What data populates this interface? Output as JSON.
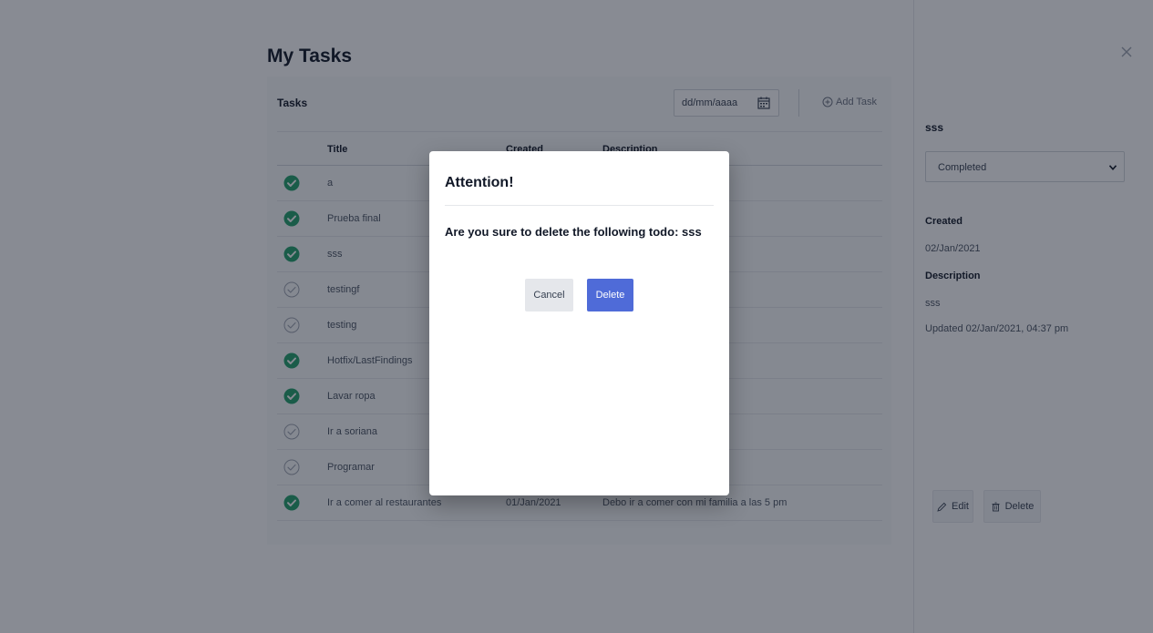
{
  "colors": {
    "accent": "#4f6bd8",
    "completed_green": "#22a06b",
    "pending_gray": "#9ca3af",
    "overlay": "#111827"
  },
  "page": {
    "title": "My Tasks"
  },
  "tasks_card": {
    "title": "Tasks",
    "date_placeholder": "dd/mm/aaaa",
    "calendar_icon": "calendar-icon",
    "add_task_label": "Add Task",
    "add_task_icon": "plus-circle-icon",
    "columns": [
      "Title",
      "Created",
      "Description"
    ],
    "rows": [
      {
        "status": "completed",
        "title": "a",
        "created": "",
        "description": ""
      },
      {
        "status": "completed",
        "title": "Prueba final",
        "created": "",
        "description": ""
      },
      {
        "status": "completed",
        "title": "sss",
        "created": "",
        "description": ""
      },
      {
        "status": "pending",
        "title": "testingf",
        "created": "",
        "description": ""
      },
      {
        "status": "pending",
        "title": "testing",
        "created": "",
        "description": ""
      },
      {
        "status": "completed",
        "title": "Hotfix/LastFindings",
        "created": "",
        "description": ""
      },
      {
        "status": "completed",
        "title": "Lavar ropa",
        "created": "",
        "description": ""
      },
      {
        "status": "pending",
        "title": "Ir a soriana",
        "created": "",
        "description": ""
      },
      {
        "status": "pending",
        "title": "Programar",
        "created": "",
        "description": ""
      },
      {
        "status": "completed",
        "title": "Ir a comer al restaurantes",
        "created": "01/Jan/2021",
        "description": "Debo ir a comer con mi familia a las 5 pm"
      }
    ]
  },
  "side_panel": {
    "close_icon": "close-icon",
    "task_name": "sss",
    "status_value": "Completed",
    "created_label": "Created",
    "created_value": "02/Jan/2021",
    "description_label": "Description",
    "description_value": "sss",
    "updated_text": "Updated 02/Jan/2021, 04:37 pm",
    "edit_label": "Edit",
    "edit_icon": "pencil-icon",
    "delete_label": "Delete",
    "delete_icon": "trash-icon"
  },
  "modal": {
    "title": "Attention!",
    "message": "Are you sure to delete the following todo: sss",
    "cancel_label": "Cancel",
    "delete_label": "Delete"
  }
}
